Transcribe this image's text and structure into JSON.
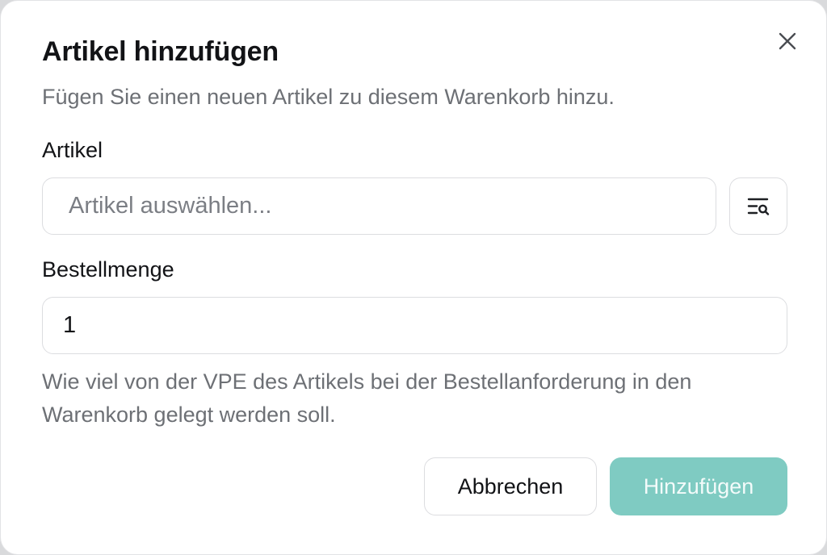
{
  "dialog": {
    "title": "Artikel hinzufügen",
    "subtitle": "Fügen Sie einen neuen Artikel zu diesem Warenkorb hinzu.",
    "close_icon": "close-icon"
  },
  "article_field": {
    "label": "Artikel",
    "placeholder": "Artikel auswählen...",
    "value": "",
    "lookup_icon": "list-search-icon"
  },
  "quantity_field": {
    "label": "Bestellmenge",
    "value": "1",
    "help_text": "Wie viel von der VPE des Artikels bei der Bestellanforderung in den Warenkorb gelegt werden soll."
  },
  "actions": {
    "cancel_label": "Abbrechen",
    "submit_label": "Hinzufügen"
  },
  "colors": {
    "primary_disabled": "#7fcbc2",
    "text_primary": "#121316",
    "text_muted": "#6d7075",
    "border": "#dcdde0"
  }
}
